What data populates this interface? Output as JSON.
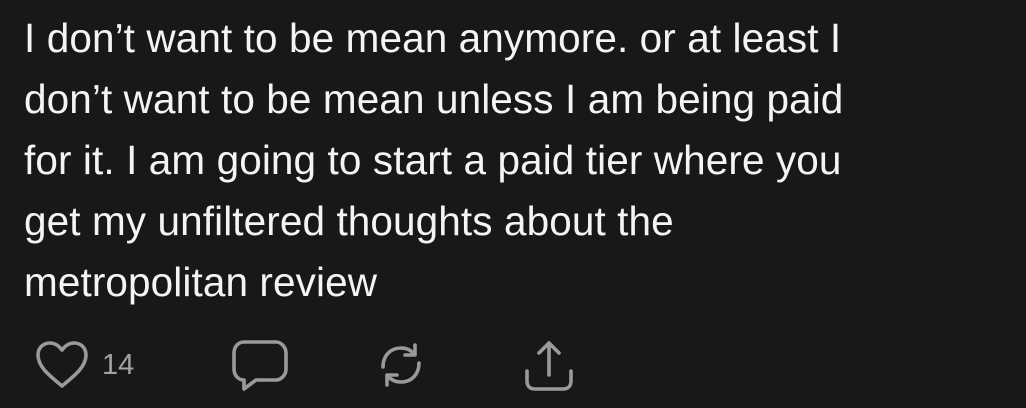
{
  "post": {
    "text": "I don’t want to be mean anymore. or at least I\ndon’t want to be mean unless I am being paid\nfor it. I am going to start a paid tier where you\nget my unfiltered thoughts about the\nmetropolitan review"
  },
  "actions": {
    "like": {
      "icon": "heart-icon",
      "count": "14"
    },
    "reply": {
      "icon": "speech-bubble-icon"
    },
    "repost": {
      "icon": "repost-icon"
    },
    "share": {
      "icon": "share-icon"
    }
  },
  "colors": {
    "background": "#18181a",
    "text": "#f4f4f4",
    "icon": "#9a9a9c"
  }
}
